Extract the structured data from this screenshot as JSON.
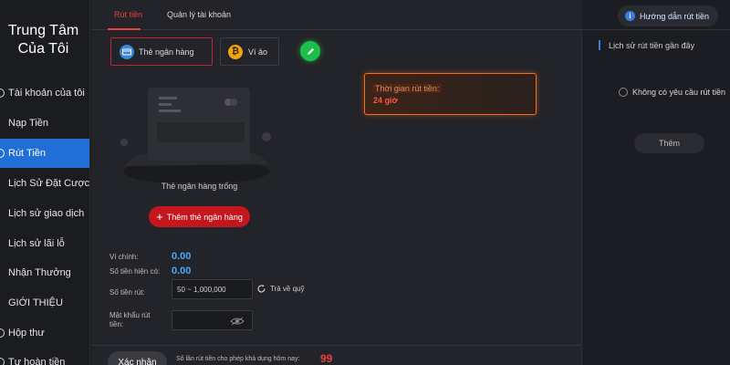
{
  "sidebar": {
    "title_line1": "Trung Tâm",
    "title_line2": "Của Tôi",
    "items": [
      {
        "label": "Tài khoản của tôi"
      },
      {
        "label": "Nạp Tiền"
      },
      {
        "label": "Rút Tiền",
        "active": true
      },
      {
        "label": "Lịch Sử Đặt Cược"
      },
      {
        "label": "Lịch sử giao dịch"
      },
      {
        "label": "Lịch sử lãi lỗ"
      },
      {
        "label": "Nhận Thưởng"
      },
      {
        "label": "GIỚI THIỆU"
      },
      {
        "label": "Hộp thư"
      },
      {
        "label": "Tự hoàn tiền"
      }
    ]
  },
  "tabs": {
    "withdraw": "Rút tiền",
    "account_mgmt": "Quản lý tài khoản"
  },
  "guide": {
    "label": "Hướng dẫn rút tiền",
    "icon": "info-icon"
  },
  "methods": {
    "bank": "Thẻ ngân hàng",
    "wallet": "Ví ảo"
  },
  "empty_card": {
    "label": "Thẻ ngân hàng trống",
    "add_button": "Thêm thẻ ngân hàng"
  },
  "form": {
    "main_wallet_label": "Ví chính:",
    "main_wallet_value": "0.00",
    "balance_label": "Số tiền hiện có:",
    "balance_value": "0.00",
    "amount_label": "Số tiền rút:",
    "amount_placeholder": "50 ~ 1,000,000",
    "refund_label": "Trả về quỹ",
    "password_label": "Mật khẩu rút tiền:"
  },
  "withdraw_time": {
    "title": "Thời gian rút tiền:",
    "value": "24 giờ"
  },
  "footer": {
    "confirm": "Xác nhận",
    "note": "Số lần rút tiền cho phép khả dụng hôm nay:",
    "count": "99"
  },
  "recent": {
    "title": "Lịch sử rút tiền gần đây",
    "empty": "Không có yêu cầu rút tiền",
    "more": "Thêm"
  },
  "colors": {
    "accent_red": "#e8413b",
    "active_blue": "#1f6fd6",
    "value_blue": "#4aa8ff",
    "time_orange": "#ff6a1a"
  }
}
